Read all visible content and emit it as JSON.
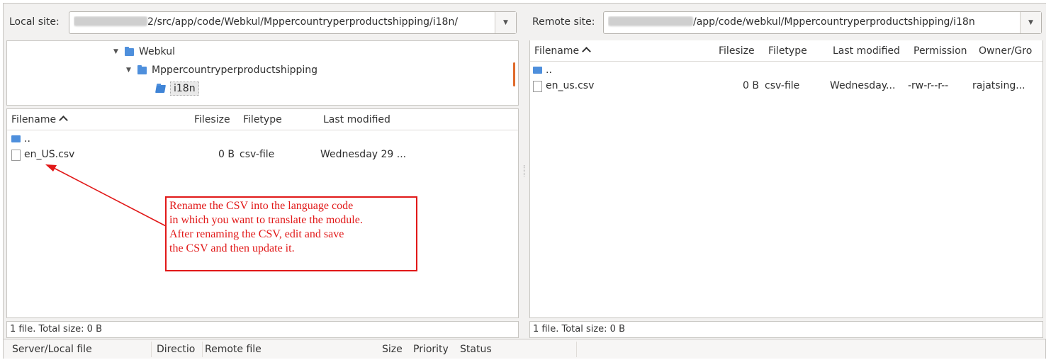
{
  "local": {
    "label": "Local site:",
    "path_visible": "2/src/app/code/Webkul/Mppercountryperproductshipping/i18n/",
    "tree": [
      {
        "label": "Webkul"
      },
      {
        "label": "Mppercountryperproductshipping"
      },
      {
        "label": "i18n"
      }
    ],
    "columns": {
      "filename": "Filename",
      "filesize": "Filesize",
      "filetype": "Filetype",
      "modified": "Last modified"
    },
    "rows": [
      {
        "name": ".."
      },
      {
        "name": "en_US.csv",
        "size": "0 B",
        "type": "csv-file",
        "modified": "Wednesday 29 ..."
      }
    ],
    "status": "1 file. Total size: 0 B"
  },
  "remote": {
    "label": "Remote site:",
    "path_visible": "/app/code/webkul/Mppercountryperproductshipping/i18n",
    "columns": {
      "filename": "Filename",
      "filesize": "Filesize",
      "filetype": "Filetype",
      "modified": "Last modified",
      "permission": "Permission",
      "owner": "Owner/Gro"
    },
    "rows": [
      {
        "name": ".."
      },
      {
        "name": "en_us.csv",
        "size": "0 B",
        "type": "csv-file",
        "modified": "Wednesday...",
        "permission": "-rw-r--r--",
        "owner": "rajatsing..."
      }
    ],
    "status": "1 file. Total size: 0 B"
  },
  "queue": {
    "columns": {
      "server": "Server/Local file",
      "direction": "Directio",
      "remote": "Remote file",
      "size": "Size",
      "priority": "Priority",
      "status": "Status"
    }
  },
  "annotation": {
    "lines": [
      "Rename the CSV into the language code",
      "in which you want to translate the module.",
      "After renaming the CSV, edit and save",
      "the CSV and then update it."
    ],
    "color": "#e11818"
  }
}
